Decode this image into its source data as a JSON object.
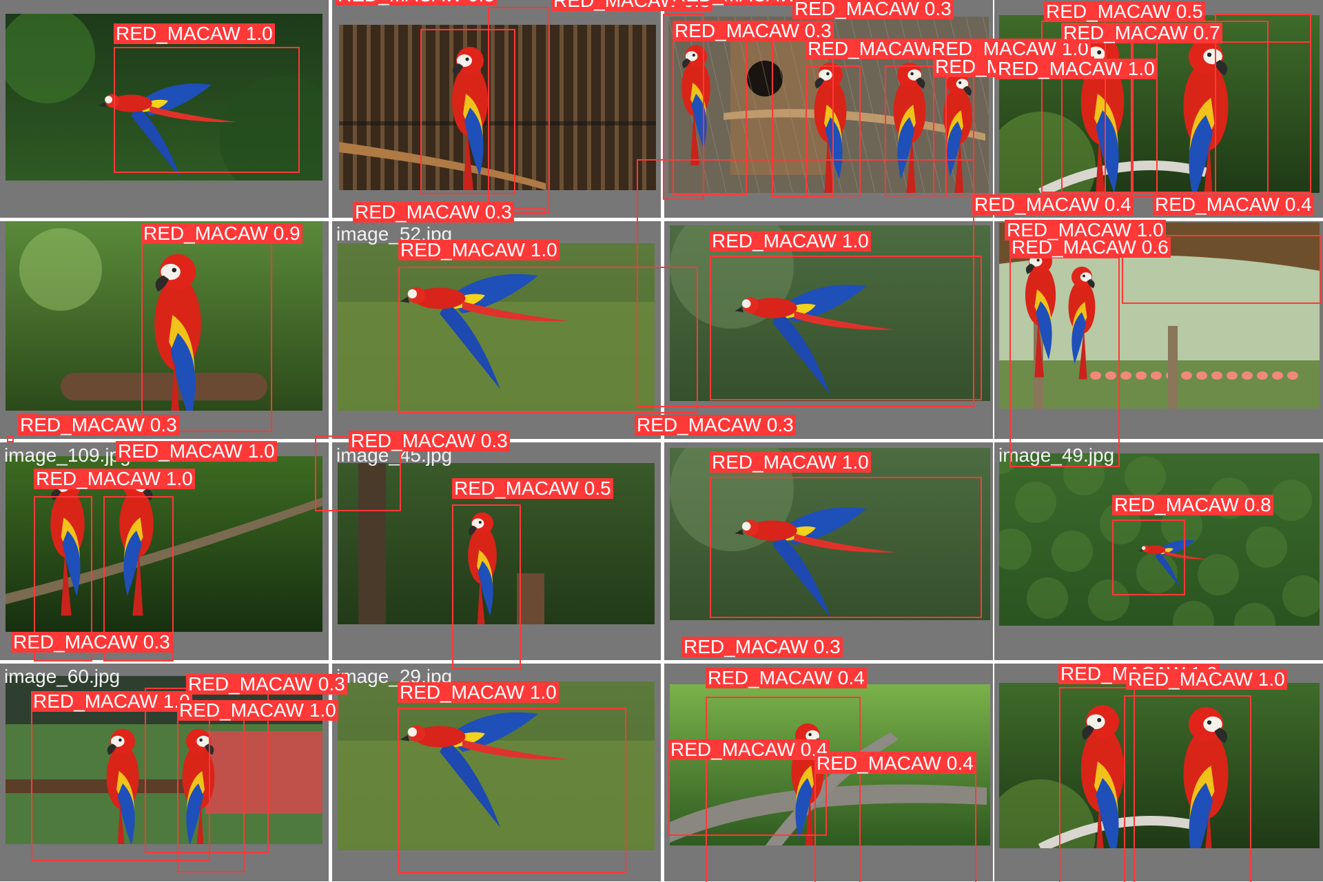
{
  "mosaic": {
    "detection_class": "RED_MACAW",
    "box_color": "#ff3838",
    "label_text_color": "#ffffff",
    "tile_background": "#777777",
    "tiles": [
      {
        "filename": "image_0.jpg",
        "filename_hidden": true,
        "scene": "jungle-flight",
        "detections": [
          {
            "label": "RED_MACAW",
            "confidence": "1.0"
          }
        ]
      },
      {
        "filename": "",
        "filename_hidden": true,
        "scene": "cage-perch",
        "detections": [
          {
            "label": "RED_MACAW",
            "confidence": "0.3"
          },
          {
            "label": "RED_MACAW",
            "confidence": "0.8"
          }
        ]
      },
      {
        "filename": "",
        "filename_hidden": true,
        "scene": "aviary-group",
        "detections": [
          {
            "label": "RED_MACAW",
            "confidence": "0.3"
          },
          {
            "label": "RED_MACAW",
            "confidence": "0.4"
          },
          {
            "label": "RED_MACAW",
            "confidence": "0.3"
          },
          {
            "label": "RED_MACAW",
            "confidence": "1.0"
          },
          {
            "label": "RED_MACAW",
            "confidence": "1.0"
          },
          {
            "label": "RED_MACAW",
            "confidence": "1.0"
          }
        ]
      },
      {
        "filename": "",
        "filename_hidden": true,
        "scene": "pair-closeup",
        "detections": [
          {
            "label": "RED_MACAW",
            "confidence": "0.5"
          },
          {
            "label": "RED_MACAW",
            "confidence": "0.7"
          },
          {
            "label": "RED_MACAW",
            "confidence": "1.0"
          },
          {
            "label": "RED_MACAW",
            "confidence": "0.4"
          },
          {
            "label": "RED_MACAW",
            "confidence": "0.4"
          }
        ]
      },
      {
        "filename": "image_91.jpg",
        "filename_hidden": true,
        "scene": "portrait-perch",
        "detections": [
          {
            "label": "RED_MACAW",
            "confidence": "0.9"
          },
          {
            "label": "RED_MACAW",
            "confidence": "0.3"
          }
        ]
      },
      {
        "filename": "image_52.jpg",
        "filename_hidden": false,
        "scene": "grass-flight",
        "detections": [
          {
            "label": "RED_MACAW",
            "confidence": "1.0"
          },
          {
            "label": "RED_MACAW",
            "confidence": "0.3"
          }
        ]
      },
      {
        "filename": "",
        "filename_hidden": true,
        "scene": "wide-flight",
        "detections": [
          {
            "label": "RED_MACAW",
            "confidence": "1.0"
          },
          {
            "label": "RED_MACAW",
            "confidence": "0.3"
          }
        ]
      },
      {
        "filename": "",
        "filename_hidden": true,
        "scene": "zoo-flamingos",
        "detections": [
          {
            "label": "RED_MACAW",
            "confidence": "0.6"
          },
          {
            "label": "RED_MACAW",
            "confidence": "1.0"
          }
        ]
      },
      {
        "filename": "image_109.jpg",
        "filename_hidden": false,
        "scene": "branch-pair",
        "detections": [
          {
            "label": "RED_MACAW",
            "confidence": "1.0"
          },
          {
            "label": "RED_MACAW",
            "confidence": "1.0"
          },
          {
            "label": "RED_MACAW",
            "confidence": "0.3"
          }
        ]
      },
      {
        "filename": "image_45.jpg",
        "filename_hidden": false,
        "scene": "forest-perch",
        "detections": [
          {
            "label": "RED_MACAW",
            "confidence": "0.5"
          },
          {
            "label": "RED_MACAW",
            "confidence": "0.3"
          }
        ]
      },
      {
        "filename": "",
        "filename_hidden": true,
        "scene": "wide-flight",
        "detections": [
          {
            "label": "RED_MACAW",
            "confidence": "1.0"
          },
          {
            "label": "RED_MACAW",
            "confidence": "0.3"
          }
        ]
      },
      {
        "filename": "image_49.jpg",
        "filename_hidden": false,
        "scene": "canopy-flight",
        "detections": [
          {
            "label": "RED_MACAW",
            "confidence": "0.8"
          }
        ]
      },
      {
        "filename": "image_60.jpg",
        "filename_hidden": false,
        "scene": "feeding-platform",
        "detections": [
          {
            "label": "RED_MACAW",
            "confidence": "1.0"
          },
          {
            "label": "RED_MACAW",
            "confidence": "1.0"
          },
          {
            "label": "RED_MACAW",
            "confidence": "0.3"
          }
        ]
      },
      {
        "filename": "image_29.jpg",
        "filename_hidden": false,
        "scene": "grass-flight",
        "detections": [
          {
            "label": "RED_MACAW",
            "confidence": "1.0"
          }
        ]
      },
      {
        "filename": "",
        "filename_hidden": true,
        "scene": "tree-canopy",
        "detections": [
          {
            "label": "RED_MACAW",
            "confidence": "0.4"
          },
          {
            "label": "RED_MACAW",
            "confidence": "0.4"
          },
          {
            "label": "RED_MACAW",
            "confidence": "0.4"
          }
        ]
      },
      {
        "filename": "",
        "filename_hidden": true,
        "scene": "pair-closeup-2",
        "detections": [
          {
            "label": "RED_MACAW",
            "confidence": "1.0"
          },
          {
            "label": "RED_MACAW",
            "confidence": "1.0"
          }
        ]
      }
    ]
  }
}
